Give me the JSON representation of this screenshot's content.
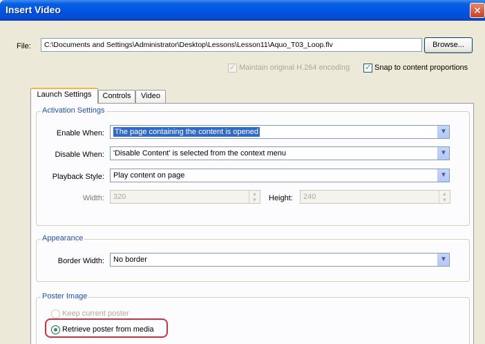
{
  "window": {
    "title": "Insert Video",
    "close_glyph": "✕"
  },
  "file": {
    "label": "File:",
    "path": "C:\\Documents and Settings\\Administrator\\Desktop\\Lessons\\Lesson11\\Aquo_T03_Loop.flv",
    "browse_label": "Browse..."
  },
  "options": {
    "maintain_encoding": {
      "label": "Maintain original H.264 encoding",
      "checked": true,
      "enabled": false
    },
    "snap_proportions": {
      "label": "Snap to content proportions",
      "checked": true,
      "enabled": true
    }
  },
  "tabs": [
    {
      "label": "Launch Settings",
      "active": true
    },
    {
      "label": "Controls",
      "active": false
    },
    {
      "label": "Video",
      "active": false
    }
  ],
  "activation": {
    "legend": "Activation Settings",
    "enable_when": {
      "label": "Enable When:",
      "value": "The page containing the content is opened"
    },
    "disable_when": {
      "label": "Disable When:",
      "value": "'Disable Content' is selected from the context menu"
    },
    "playback_style": {
      "label": "Playback Style:",
      "value": "Play content on page"
    },
    "width": {
      "label": "Width:",
      "value": "320"
    },
    "height": {
      "label": "Height:",
      "value": "240"
    }
  },
  "appearance": {
    "legend": "Appearance",
    "border_width": {
      "label": "Border Width:",
      "value": "No border"
    }
  },
  "poster": {
    "legend": "Poster Image",
    "keep_current": {
      "label": "Keep current poster",
      "selected": false,
      "enabled": false
    },
    "retrieve": {
      "label": "Retrieve poster from media",
      "selected": true,
      "enabled": true
    }
  },
  "icons": {
    "dropdown": "chevron-down-icon",
    "check": "checkmark-icon",
    "close": "close-icon"
  },
  "colors": {
    "titlebar": "#0054e3",
    "selection": "#316ac5",
    "legend_text": "#1e4fa8",
    "callout_ring": "#d22e3c"
  }
}
